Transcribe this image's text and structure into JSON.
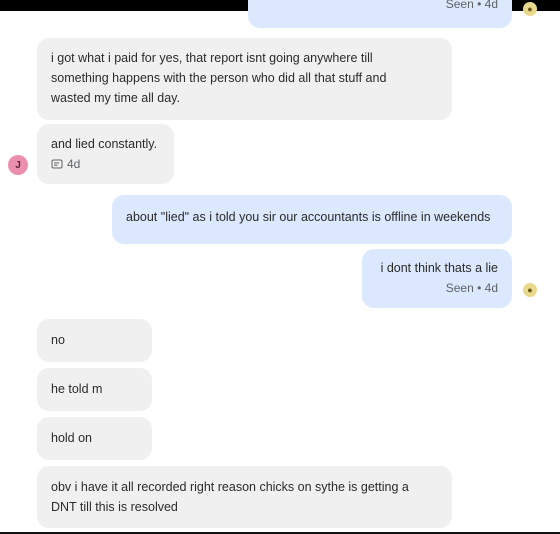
{
  "top_bubble": {
    "meta_text": "Seen • 4d"
  },
  "messages": [
    {
      "id": "m1",
      "text_lines": [
        "i got what i paid for yes, that report isnt going anywhere till",
        "something happens with the person who did all that stuff and",
        "wasted my time all day."
      ]
    },
    {
      "id": "m2",
      "text": "and lied constantly.",
      "meta": "4d"
    },
    {
      "id": "m3",
      "text": "about \"lied\" as i told you sir our accountants is offline in weekends"
    },
    {
      "id": "m4",
      "text": "i dont think thats a lie",
      "meta": "Seen • 4d"
    },
    {
      "id": "m5",
      "text": "no"
    },
    {
      "id": "m6",
      "text": "he told m"
    },
    {
      "id": "m7",
      "text": "hold on"
    },
    {
      "id": "m8",
      "text_lines": [
        "obv i have it all recorded right reason chicks on sythe is getting a",
        "DNT till this is resolved"
      ]
    }
  ],
  "avatar": {
    "initial": "J",
    "color": "#ec8fae"
  },
  "colors": {
    "incoming_bubble": "#f0f0f0",
    "outgoing_bubble": "#dbe8fd",
    "meta_text": "#5f6368"
  }
}
